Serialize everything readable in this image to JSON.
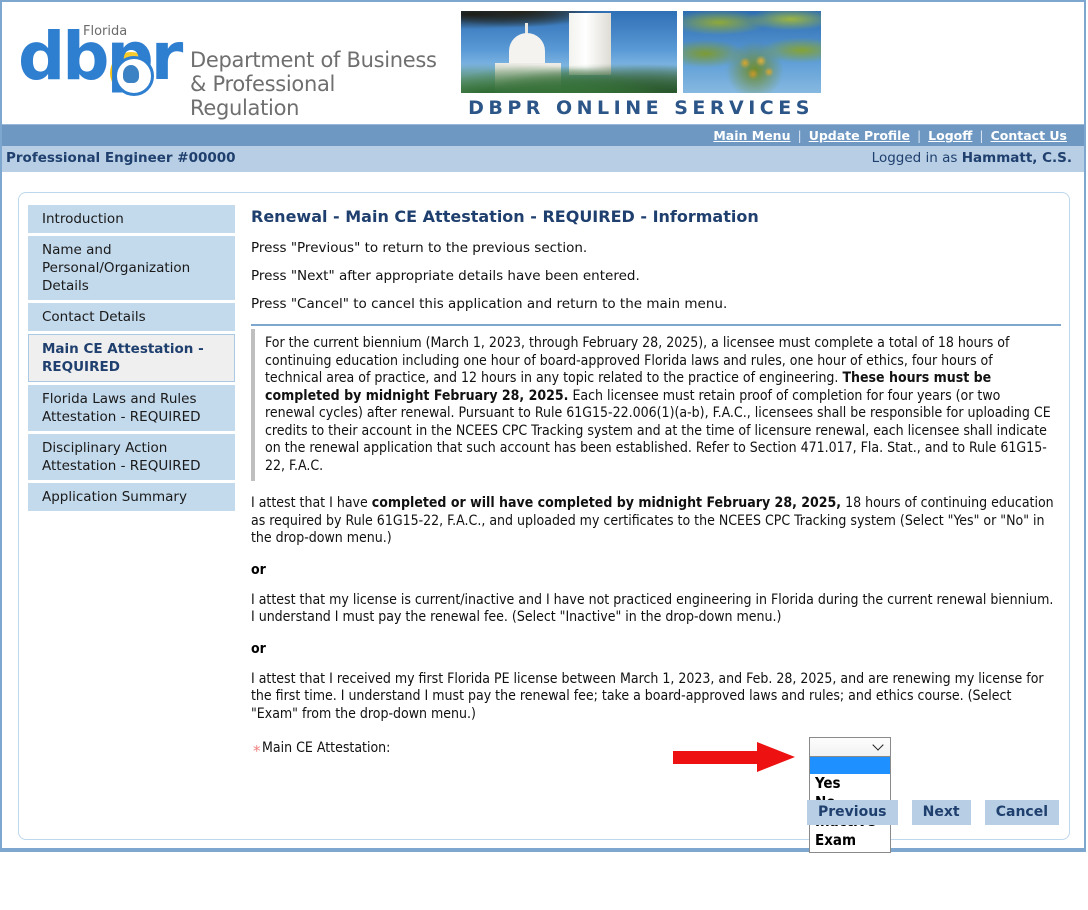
{
  "header": {
    "logo": {
      "mark": "dbpr",
      "florida": "Florida",
      "name_line1": "Department of Business",
      "name_line2": "& Professional Regulation"
    },
    "banner_caption": "DBPR  ONLINE  SERVICES"
  },
  "nav": {
    "links": [
      {
        "label": "Main Menu"
      },
      {
        "label": "Update Profile"
      },
      {
        "label": "Logoff"
      },
      {
        "label": "Contact Us"
      }
    ],
    "separator": "|"
  },
  "info_bar": {
    "license": "Professional Engineer #00000",
    "logged_in_prefix": "Logged in as ",
    "user": "Hammatt, C.S."
  },
  "sidebar": {
    "items": [
      {
        "label": "Introduction",
        "active": false
      },
      {
        "label": "Name and Personal/Organization Details",
        "active": false
      },
      {
        "label": "Contact Details",
        "active": false
      },
      {
        "label": "Main CE Attestation - REQUIRED",
        "active": true
      },
      {
        "label": "Florida Laws and Rules Attestation - REQUIRED",
        "active": false
      },
      {
        "label": "Disciplinary Action Attestation - REQUIRED",
        "active": false
      },
      {
        "label": "Application Summary",
        "active": false
      }
    ]
  },
  "main": {
    "heading": "Renewal - Main CE Attestation - REQUIRED - Information",
    "instructions": [
      "Press \"Previous\" to return to the previous section.",
      "Press \"Next\" after appropriate details have been entered.",
      "Press \"Cancel\" to cancel this application and return to the main menu."
    ],
    "info_box": {
      "part1": "For the current biennium (March 1, 2023, through February 28, 2025), a licensee must complete a total of 18 hours of continuing education including one hour of board-approved Florida laws and rules, one hour of ethics, four hours of technical area of practice, and 12 hours in any topic related to the practice of engineering. ",
      "bold1": "These hours must be completed by midnight February 28, 2025.",
      "part2": " Each licensee must retain proof of completion for four years (or two renewal cycles) after renewal. Pursuant to Rule 61G15-22.006(1)(a-b), F.A.C., licensees shall be responsible for uploading CE credits to their account in the NCEES CPC Tracking system and at the time of licensure renewal, each licensee shall indicate on the renewal application that such account has been established. Refer to Section 471.017, Fla. Stat., and to Rule 61G15-22, F.A.C."
    },
    "attestation_1": {
      "part1": "I attest that I have ",
      "bold1": "completed or will have completed by midnight February 28, 2025,",
      "part2": " 18 hours of continuing education as required by Rule 61G15-22, F.A.C., and uploaded my certificates to the NCEES CPC Tracking system (Select \"Yes\" or \"No\" in the drop-down menu.)"
    },
    "or_1": "or",
    "attestation_2": "I attest that my license is current/inactive and I have not practiced engineering in Florida during the current renewal biennium. I understand I must pay the renewal fee. (Select \"Inactive\" in the drop-down menu.)",
    "or_2": "or",
    "attestation_3": "I attest that I received my first Florida PE license between March 1, 2023, and Feb. 28, 2025, and are renewing my license for the first time. I understand I must pay the renewal fee; take a board-approved laws and rules; and ethics course. (Select \"Exam\" from the drop-down menu.)",
    "field": {
      "required_marker": "*",
      "label": "Main CE Attestation:",
      "selected_value": "",
      "options": [
        "",
        "Yes",
        "No",
        "Inactive",
        "Exam"
      ],
      "option_labels": {
        "blank": "",
        "yes": "Yes",
        "no": "No",
        "inactive": "Inactive",
        "exam": "Exam"
      },
      "expanded": true
    },
    "buttons": [
      {
        "label": "Previous"
      },
      {
        "label": "Next"
      },
      {
        "label": "Cancel"
      }
    ]
  },
  "colors": {
    "nav_bar": "#6e98c2",
    "info_bar": "#b7cee4",
    "sidebar_item": "#c3d9ec",
    "heading": "#1f3f6e",
    "arrow": "#ee1111",
    "highlight": "#1e90ff",
    "required_star": "#f08080"
  }
}
